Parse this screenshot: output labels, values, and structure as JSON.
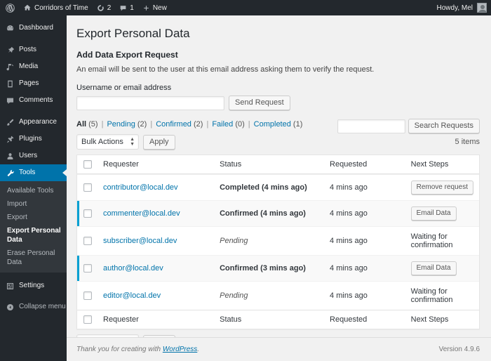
{
  "adminbar": {
    "logo_icon": "wordpress-logo-icon",
    "site_name": "Corridors of Time",
    "home_icon": "home-icon",
    "updates_icon": "updates-icon",
    "updates_count": "2",
    "comments_icon": "comment-bubble-icon",
    "comments_count": "1",
    "new_icon": "plus-icon",
    "new_label": "New",
    "howdy": "Howdy, Mel",
    "avatar_icon": "user-avatar-icon"
  },
  "sidebar": {
    "items": [
      {
        "label": "Dashboard",
        "icon": "dashboard-icon",
        "current": false
      },
      {
        "label": "Posts",
        "icon": "pin-icon",
        "current": false
      },
      {
        "label": "Media",
        "icon": "media-icon",
        "current": false
      },
      {
        "label": "Pages",
        "icon": "page-icon",
        "current": false
      },
      {
        "label": "Comments",
        "icon": "comment-icon",
        "current": false
      },
      {
        "label": "Appearance",
        "icon": "brush-icon",
        "current": false
      },
      {
        "label": "Plugins",
        "icon": "plugin-icon",
        "current": false
      },
      {
        "label": "Users",
        "icon": "users-icon",
        "current": false
      },
      {
        "label": "Tools",
        "icon": "tools-icon",
        "current": true
      }
    ],
    "submenu": [
      {
        "label": "Available Tools",
        "current": false
      },
      {
        "label": "Import",
        "current": false
      },
      {
        "label": "Export",
        "current": false
      },
      {
        "label": "Export Personal Data",
        "current": true
      },
      {
        "label": "Erase Personal Data",
        "current": false
      }
    ],
    "settings": {
      "label": "Settings",
      "icon": "settings-icon"
    },
    "collapse": {
      "label": "Collapse menu",
      "icon": "collapse-icon"
    }
  },
  "main": {
    "page_title": "Export Personal Data",
    "section_title": "Add Data Export Request",
    "description": "An email will be sent to the user at this email address asking them to verify the request.",
    "field_label": "Username or email address",
    "field_value": "",
    "field_placeholder": "",
    "send_button": "Send Request",
    "filters": [
      {
        "label": "All",
        "count": "(5)",
        "current": true
      },
      {
        "label": "Pending",
        "count": "(2)",
        "current": false
      },
      {
        "label": "Confirmed",
        "count": "(2)",
        "current": false
      },
      {
        "label": "Failed",
        "count": "(0)",
        "current": false
      },
      {
        "label": "Completed",
        "count": "(1)",
        "current": false
      }
    ],
    "search": {
      "value": "",
      "placeholder": "",
      "button": "Search Requests"
    },
    "bulk": {
      "selected": "Bulk Actions",
      "options": [
        "Bulk Actions"
      ],
      "apply": "Apply"
    },
    "items_count": "5 items",
    "columns": [
      "Requester",
      "Status",
      "Requested",
      "Next Steps"
    ],
    "rows": [
      {
        "requester": "contributor@local.dev",
        "status": "Completed (4 mins ago)",
        "status_style": "strong",
        "requested": "4 mins ago",
        "next_step": "Remove request",
        "next_is_button": true,
        "confirmed_marker": false
      },
      {
        "requester": "commenter@local.dev",
        "status": "Confirmed (4 mins ago)",
        "status_style": "strong",
        "requested": "4 mins ago",
        "next_step": "Email Data",
        "next_is_button": true,
        "confirmed_marker": true
      },
      {
        "requester": "subscriber@local.dev",
        "status": "Pending",
        "status_style": "pending",
        "requested": "4 mins ago",
        "next_step": "Waiting for confirmation",
        "next_is_button": false,
        "confirmed_marker": false
      },
      {
        "requester": "author@local.dev",
        "status": "Confirmed (3 mins ago)",
        "status_style": "strong",
        "requested": "4 mins ago",
        "next_step": "Email Data",
        "next_is_button": true,
        "confirmed_marker": true
      },
      {
        "requester": "editor@local.dev",
        "status": "Pending",
        "status_style": "pending",
        "requested": "4 mins ago",
        "next_step": "Waiting for confirmation",
        "next_is_button": false,
        "confirmed_marker": false
      }
    ]
  },
  "footer": {
    "thanks_prefix": "Thank you for creating with ",
    "thanks_link": "WordPress",
    "thanks_suffix": ".",
    "version": "Version 4.9.6"
  },
  "colors": {
    "admin_bar": "#23282d",
    "sidebar": "#23282d",
    "submenu": "#32373c",
    "accent": "#0073aa",
    "confirmed_marker": "#00a0d2",
    "body_bg": "#f1f1f1"
  }
}
